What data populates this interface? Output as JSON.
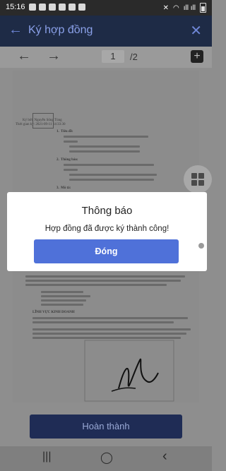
{
  "status": {
    "time": "15:16",
    "icons": [
      "message-icon",
      "message-icon",
      "settings-icon",
      "settings-icon",
      "settings-icon",
      "image-icon"
    ],
    "signal": "ıll ıll"
  },
  "appbar": {
    "title": "Ký hợp đồng",
    "back_icon": "←",
    "close_icon": "✕"
  },
  "pager": {
    "current_page": "1",
    "total": "/2",
    "prev_icon": "←",
    "next_icon": "→",
    "add_icon": "+"
  },
  "document": {
    "signer": "Ký bởi: Nguyễn Sông Tùng",
    "sign_time": "Thời gian ký: 2021-09-11 14:33:30",
    "section1": "1.",
    "section1_title": "Tiêu đề:",
    "section2": "2.",
    "section2_title": "Thông báo:",
    "section3": "3.",
    "section3_title": "Mô tả:",
    "paragraph_heading": "LĨNH VỰC KINH DOANH"
  },
  "dialog": {
    "title": "Thông báo",
    "message": "Hợp đồng đã được ký thành công!",
    "button": "Đóng"
  },
  "footer": {
    "finish_button": "Hoàn thành"
  },
  "navbar": {
    "recents": "|||",
    "home": "◯",
    "back": "‹"
  },
  "colors": {
    "primary": "#4f71d9",
    "appbar": "#1e2b46",
    "finish": "#1f2c55"
  }
}
